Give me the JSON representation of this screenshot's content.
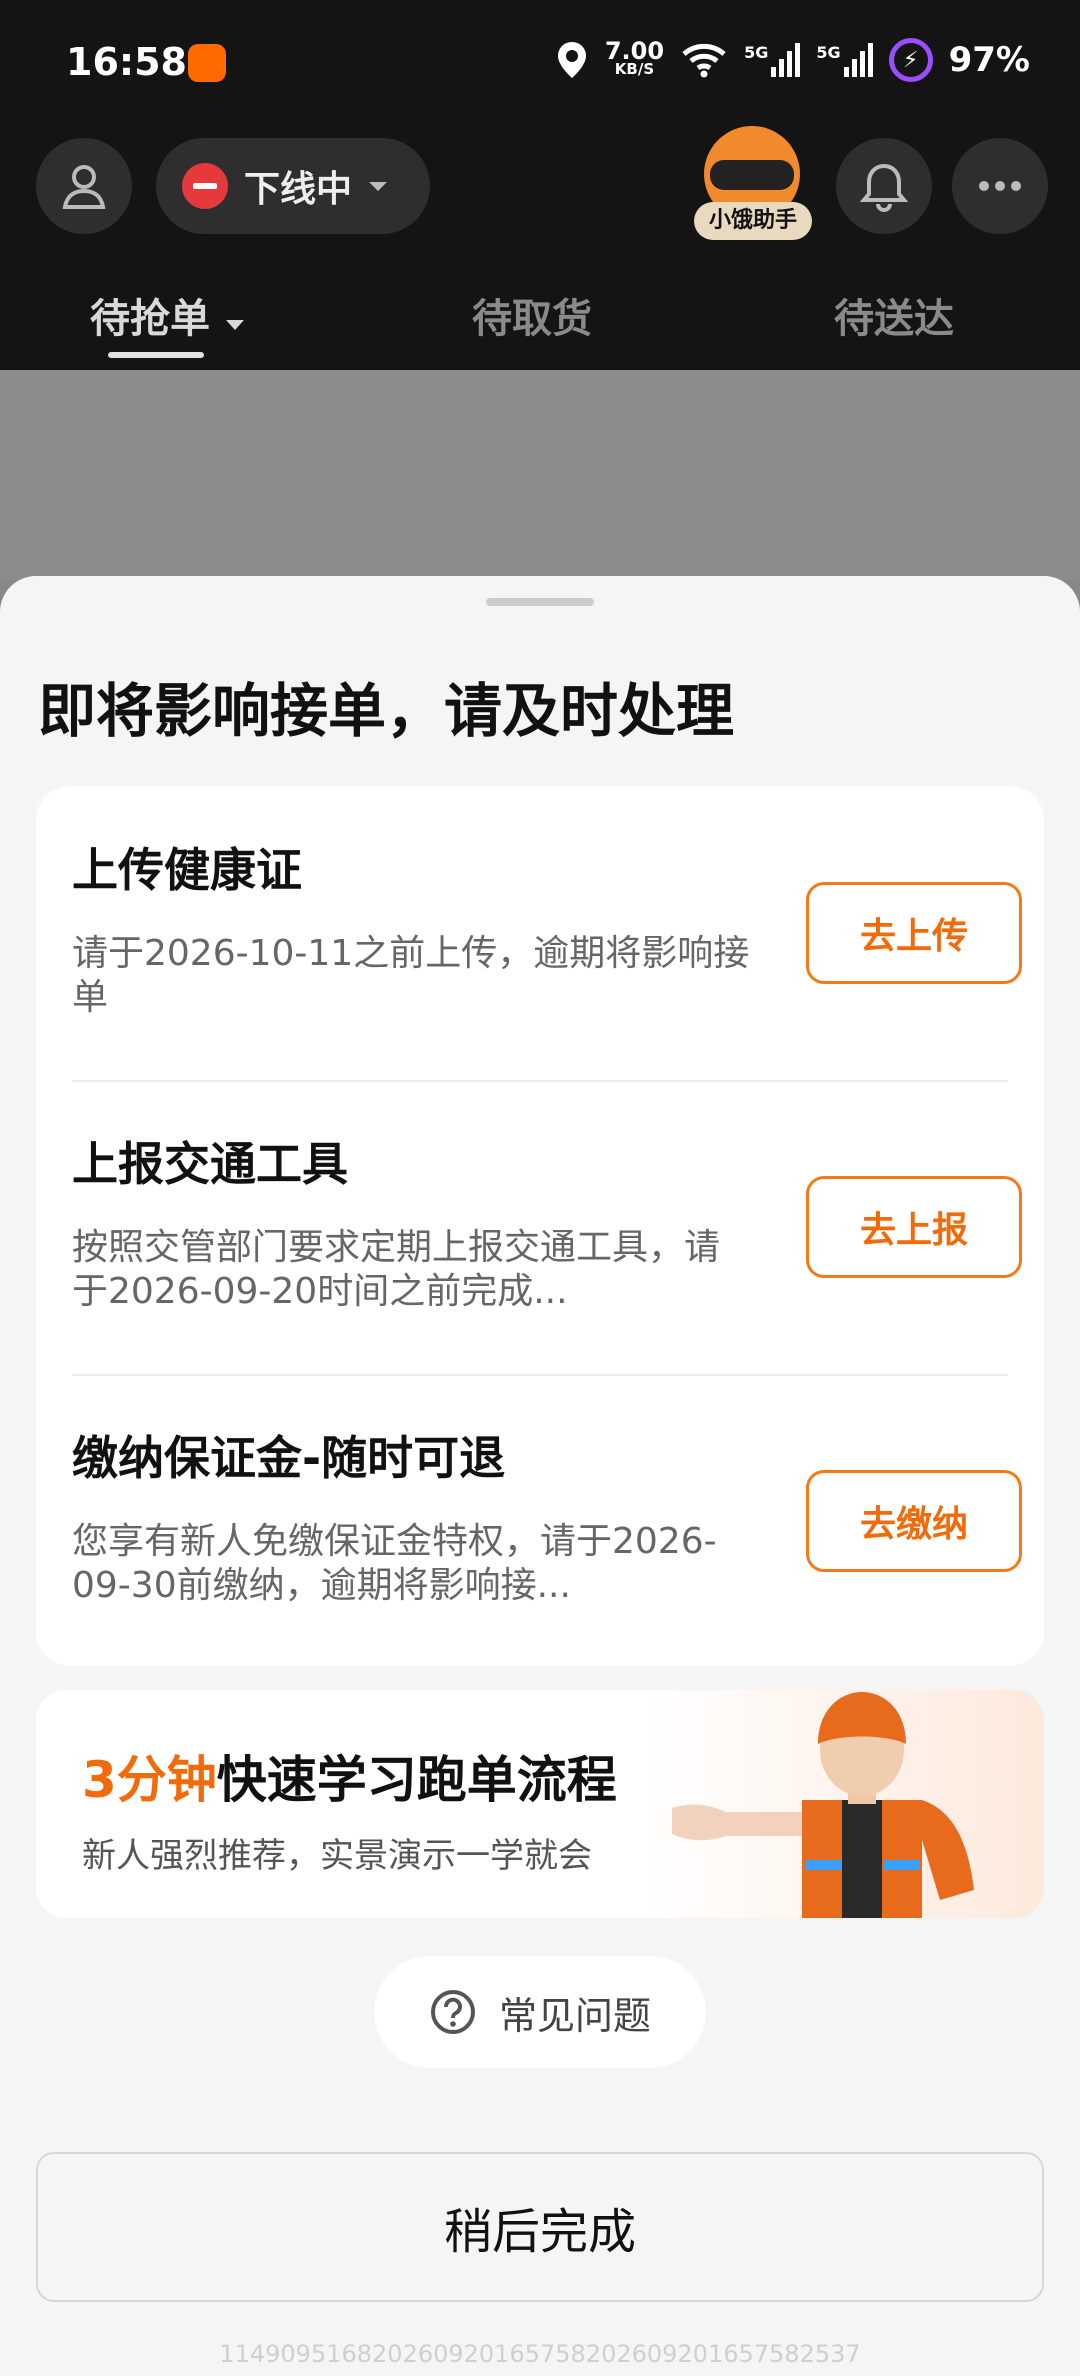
{
  "status_bar": {
    "time": "16:58",
    "speed_value": "7.00",
    "speed_unit": "KB/S",
    "sim1": "5G",
    "sim2": "5G",
    "battery": "97%"
  },
  "top_nav": {
    "status_label": "下线中",
    "assistant_label": "小饿助手"
  },
  "tabs": [
    {
      "label": "待抢单"
    },
    {
      "label": "待取货"
    },
    {
      "label": "待送达"
    }
  ],
  "sheet": {
    "title": "即将影响接单，请及时处理",
    "tasks": [
      {
        "title": "上传健康证",
        "desc": "请于2026-10-11之前上传，逾期将影响接单",
        "action": "去上传"
      },
      {
        "title": "上报交通工具",
        "desc": "按照交管部门要求定期上报交通工具，请于2026-09-20时间之前完成...",
        "action": "去上报"
      },
      {
        "title": "缴纳保证金-随时可退",
        "desc": "您享有新人免缴保证金特权，请于2026-09-30前缴纳，逾期将影响接...",
        "action": "去缴纳"
      }
    ],
    "promo": {
      "title_accent": "3分钟",
      "title_rest": "快速学习跑单流程",
      "subtitle": "新人强烈推荐，实景演示一学就会"
    },
    "faq_label": "常见问题",
    "later_label": "稍后完成",
    "footer_id": "11490951682026092016575820260920165758​2537"
  },
  "colors": {
    "accent": "#f26b0a",
    "danger": "#e5393c",
    "header_bg": "#141414"
  }
}
